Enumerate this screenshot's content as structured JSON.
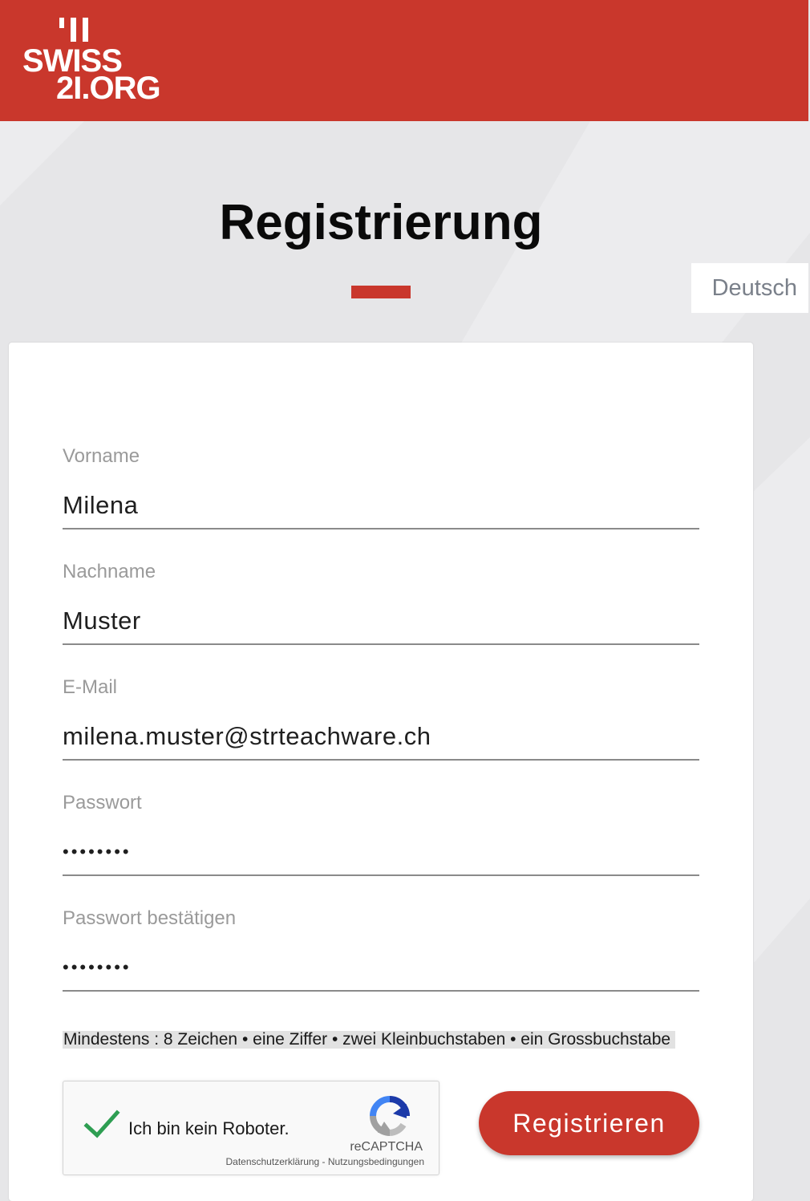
{
  "brand": {
    "logo_line1": "SWISS",
    "logo_line2": "2I.ORG",
    "color": "#c9372c"
  },
  "language": {
    "selected": "Deutsch"
  },
  "page": {
    "title": "Registrierung"
  },
  "form": {
    "fields": [
      {
        "label": "Vorname",
        "value": "Milena",
        "type": "text"
      },
      {
        "label": "Nachname",
        "value": "Muster",
        "type": "text"
      },
      {
        "label": "E-Mail",
        "value": "milena.muster@strteachware.ch",
        "type": "email"
      },
      {
        "label": "Passwort",
        "value": "12345678",
        "type": "password"
      },
      {
        "label": "Passwort bestätigen",
        "value": "12345678",
        "type": "password"
      }
    ],
    "password_hint": "Mindestens : 8 Zeichen • eine Ziffer • zwei Kleinbuchstaben • ein Grossbuchstabe",
    "submit_label": "Registrieren"
  },
  "captcha": {
    "label": "Ich bin kein Roboter.",
    "checked": true,
    "brand": "reCAPTCHA",
    "privacy_link": "Datenschutzerklärung",
    "separator": " - ",
    "terms_link": "Nutzungsbedingungen"
  }
}
